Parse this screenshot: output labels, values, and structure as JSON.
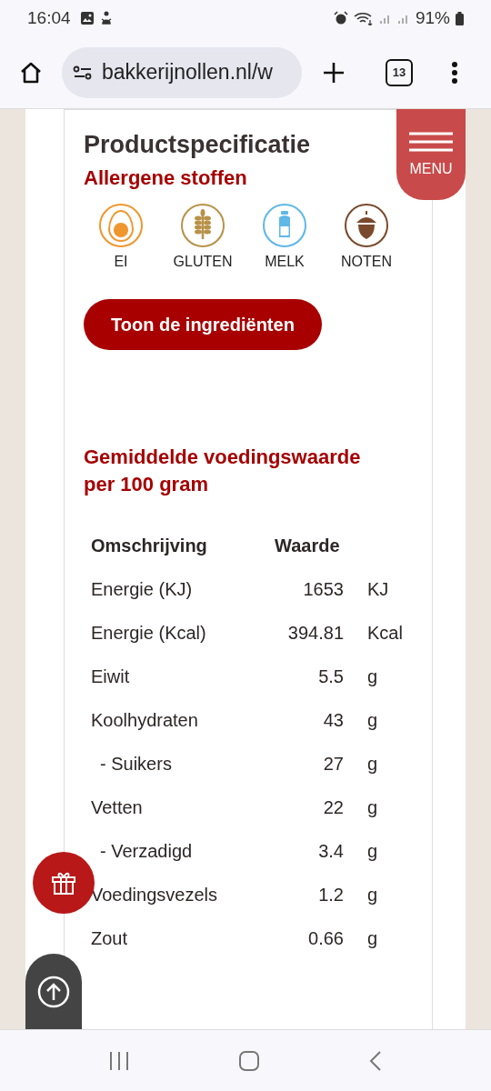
{
  "status_bar": {
    "time": "16:04",
    "battery": "91%"
  },
  "browser": {
    "url": "bakkerijnollen.nl/w",
    "tab_count": "13"
  },
  "menu_button": {
    "label": "MENU"
  },
  "section": {
    "title": "Productspecificatie",
    "allergens_title": "Allergene stoffen"
  },
  "allergens": [
    {
      "label": "EI",
      "kind": "egg",
      "color": "#f0962e"
    },
    {
      "label": "GLUTEN",
      "kind": "grain",
      "color": "#b89248"
    },
    {
      "label": "MELK",
      "kind": "bottle",
      "color": "#5fb8e6"
    },
    {
      "label": "NOTEN",
      "kind": "acorn",
      "color": "#7a4a2c"
    }
  ],
  "ingredients_button": "Toon de ingrediënten",
  "nutrition": {
    "title": "Gemiddelde voedingswaarde per 100 gram",
    "columns": [
      "Omschrijving",
      "Waarde"
    ],
    "rows": [
      {
        "name": "Energie (KJ)",
        "value": "1653",
        "unit": "KJ",
        "kind": "main"
      },
      {
        "name": "Energie (Kcal)",
        "value": "394.81",
        "unit": "Kcal",
        "kind": "main"
      },
      {
        "name": "Eiwit",
        "value": "5.5",
        "unit": "g",
        "kind": "main"
      },
      {
        "name": "Koolhydraten",
        "value": "43",
        "unit": "g",
        "kind": "main"
      },
      {
        "name": "- Suikers",
        "value": "27",
        "unit": "g",
        "kind": "sub"
      },
      {
        "name": "Vetten",
        "value": "22",
        "unit": "g",
        "kind": "main"
      },
      {
        "name": "- Verzadigd",
        "value": "3.4",
        "unit": "g",
        "kind": "sub"
      },
      {
        "name": "Voedingsvezels",
        "value": "1.2",
        "unit": "g",
        "kind": "main"
      },
      {
        "name": "Zout",
        "value": "0.66",
        "unit": "g",
        "kind": "main"
      }
    ]
  }
}
